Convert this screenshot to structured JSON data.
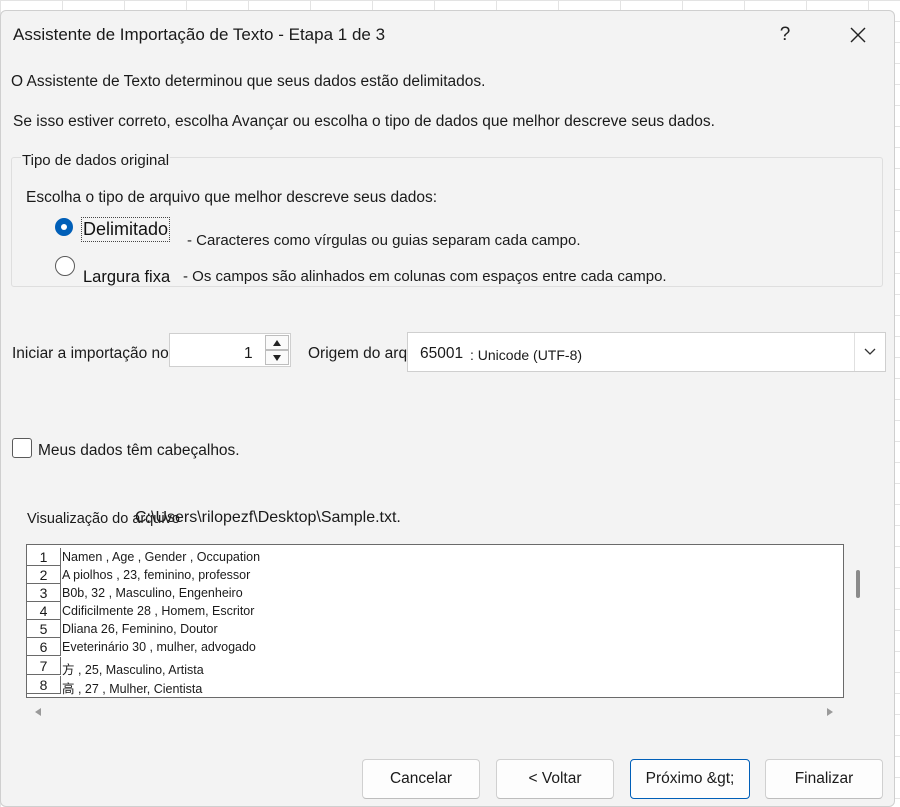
{
  "window": {
    "title": "Assistente de Importação de Texto - Etapa 1 de 3",
    "help_label": "?"
  },
  "intro": {
    "line1": "O Assistente de Texto determinou que seus dados estão delimitados.",
    "line2": "Se isso estiver correto, escolha Avançar ou escolha o tipo de dados que melhor descreve seus dados."
  },
  "original_data_type": {
    "legend": "Tipo de dados original",
    "prompt": "Escolha o tipo de arquivo que melhor descreve seus dados:",
    "options": [
      {
        "label": "Delimitado",
        "description": "- Caracteres como vírgulas ou guias separam cada campo.",
        "selected": true
      },
      {
        "label": "Largura fixa",
        "description": "- Os campos são alinhados em colunas com espaços entre cada campo.",
        "selected": false
      }
    ]
  },
  "start_import": {
    "label": "Iniciar a importação no reboque:",
    "value": "1"
  },
  "file_origin": {
    "label": "Origem do arquivo",
    "code": "65001",
    "name": ": Unicode (UTF-8)"
  },
  "headers_checkbox": {
    "label": "Meus dados têm cabeçalhos.",
    "checked": false
  },
  "preview": {
    "label": "Visualização do arquivo",
    "path": "C:\\Users\\rilopezf\\Desktop\\Sample.txt.",
    "rows": [
      {
        "num": "1",
        "text": "Namen , Age , Gender , Occupation"
      },
      {
        "num": "2",
        "text": "A piolhos , 23, feminino, professor"
      },
      {
        "num": "3",
        "text": "B0b, 32 , Masculino, Engenheiro"
      },
      {
        "num": "4",
        "text": "Cdificilmente 28 , Homem, Escritor"
      },
      {
        "num": "5",
        "text": "Dliana 26, Feminino, Doutor"
      },
      {
        "num": "6",
        "text": "Eveterinário 30 , mulher, advogado"
      },
      {
        "num": "7",
        "text": "方 , 25, Masculino, Artista"
      },
      {
        "num": "8",
        "text": "高 , 27 , Mulher, Cientista"
      }
    ]
  },
  "buttons": {
    "cancel": "Cancelar",
    "back": "< Voltar",
    "next": "Próximo &gt;",
    "finish": "Finalizar"
  },
  "colors": {
    "accent": "#005fb8",
    "dialog_bg": "#f3f3f3"
  }
}
